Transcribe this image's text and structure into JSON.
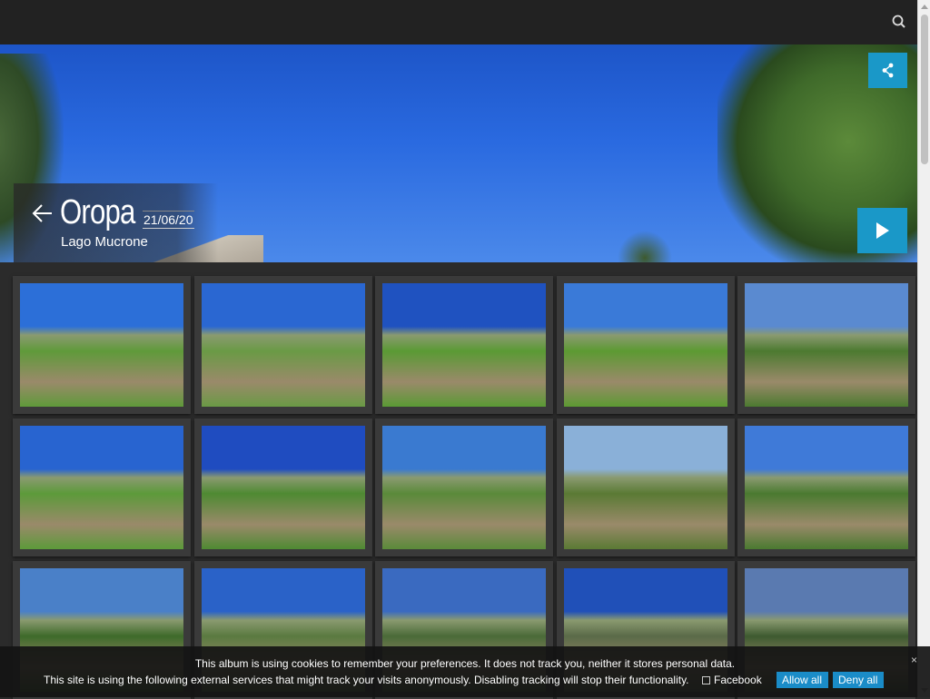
{
  "header": {
    "search_icon": "search-icon"
  },
  "hero": {
    "title": "Oropa",
    "date": "21/06/20",
    "subtitle": "Lago Mucrone",
    "share_icon": "share-icon",
    "play_icon": "play-icon",
    "back_icon": "arrow-left-icon"
  },
  "thumbnails": [
    {
      "sky": "#2c6fd8",
      "ground": "#5f9a3a"
    },
    {
      "sky": "#2a67d2",
      "ground": "#6a9a45"
    },
    {
      "sky": "#1f52c0",
      "ground": "#5a9a34"
    },
    {
      "sky": "#3a7ad8",
      "ground": "#5c9a32"
    },
    {
      "sky": "#5a8ad0",
      "ground": "#4c7a30"
    },
    {
      "sky": "#2864d0",
      "ground": "#5c9a3a"
    },
    {
      "sky": "#1f4cc0",
      "ground": "#4e8a32"
    },
    {
      "sky": "#3a7ad0",
      "ground": "#5a8a3a"
    },
    {
      "sky": "#8ab0d8",
      "ground": "#5a7a34"
    },
    {
      "sky": "#3f7ad8",
      "ground": "#4a7a30"
    },
    {
      "sky": "#4a80c8",
      "ground": "#3e6a2a"
    },
    {
      "sky": "#2a62c8",
      "ground": "#5a7a40"
    },
    {
      "sky": "#3a6ac0",
      "ground": "#4a6a38"
    },
    {
      "sky": "#2050b8",
      "ground": "#5a6a48"
    },
    {
      "sky": "#5a7ab0",
      "ground": "#3e5a30"
    }
  ],
  "cookies": {
    "line1": "This album is using cookies to remember your preferences. It does not track you, neither it stores personal data.",
    "line2": "This site is using the following external services that might track your visits anonymously. Disabling tracking will stop their functionality.",
    "facebook_label": "Facebook",
    "allow_label": "Allow all",
    "deny_label": "Deny all",
    "close_label": "×"
  }
}
